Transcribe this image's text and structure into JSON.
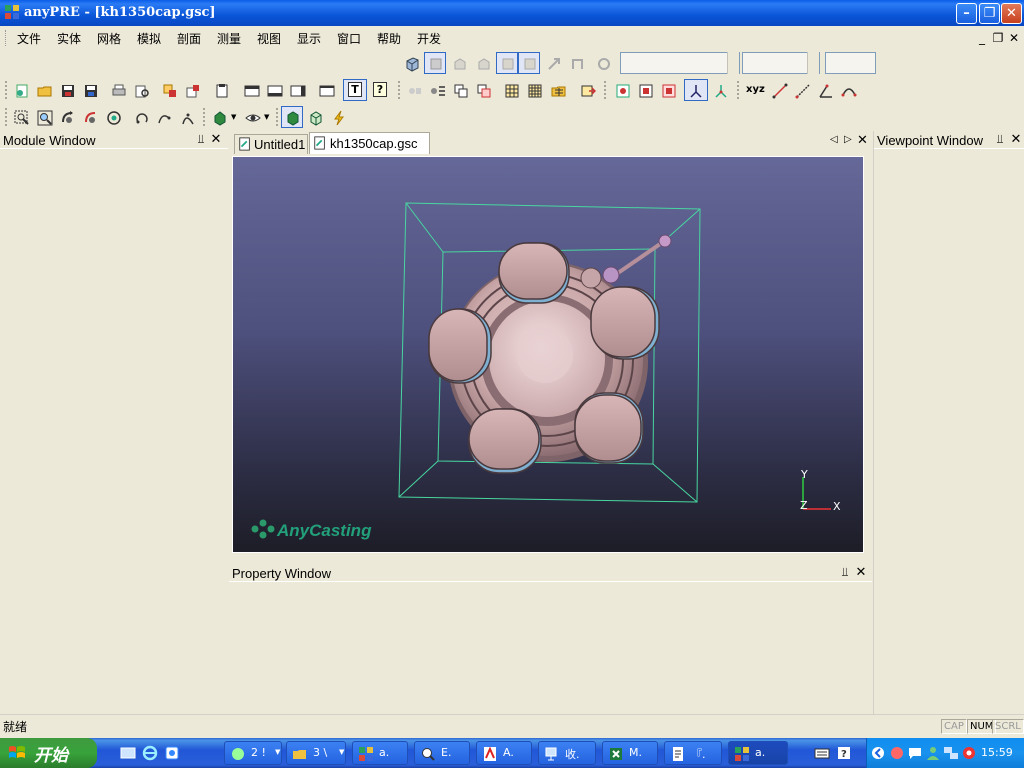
{
  "window": {
    "title": "anyPRE - [kh1350cap.gsc]",
    "minimize_glyph": "–",
    "maximize_glyph": "❐",
    "close_glyph": "✕"
  },
  "menu": {
    "items": [
      "文件",
      "实体",
      "网格",
      "模拟",
      "剖面",
      "测量",
      "视图",
      "显示",
      "窗口",
      "帮助",
      "开发"
    ],
    "mdi_minimize": "_",
    "mdi_restore": "❐",
    "mdi_close": "✕"
  },
  "toolbar": {
    "xyz_label": "xyz",
    "help_glyph": "?",
    "text_glyph": "T"
  },
  "panels": {
    "module": {
      "title": "Module Window"
    },
    "viewpoint": {
      "title": "Viewpoint Window"
    },
    "property": {
      "title": "Property Window"
    },
    "pin_glyph": "⫫",
    "close_glyph": "✕"
  },
  "tabs": {
    "items": [
      {
        "label": "Untitled1",
        "active": false
      },
      {
        "label": "kh1350cap.gsc",
        "active": true
      }
    ],
    "nav_left": "◁",
    "nav_right": "▷",
    "close": "✕"
  },
  "viewport": {
    "brand": "AnyCasting",
    "axis_y": "Y",
    "axis_z": "Z",
    "axis_x": "X",
    "bounding_box_color": "#48d6a0"
  },
  "status": {
    "text": "就绪",
    "cap": "CAP",
    "num": "NUM",
    "scrl": "SCRL"
  },
  "taskbar": {
    "start_label": "开始",
    "buttons": [
      {
        "label": "2 !",
        "icon": "program-group-icon"
      },
      {
        "label": "3 \\",
        "icon": "folder-icon"
      },
      {
        "label": "a.",
        "icon": "anycasting-icon"
      },
      {
        "label": "E.",
        "icon": "search-icon"
      },
      {
        "label": "A.",
        "icon": "pdf-icon"
      },
      {
        "label": "收.",
        "icon": "network-icon"
      },
      {
        "label": "M.",
        "icon": "excel-icon"
      },
      {
        "label": "『.",
        "icon": "document-icon"
      },
      {
        "label": "a.",
        "icon": "anycasting-icon"
      }
    ],
    "clock": "15:59"
  }
}
